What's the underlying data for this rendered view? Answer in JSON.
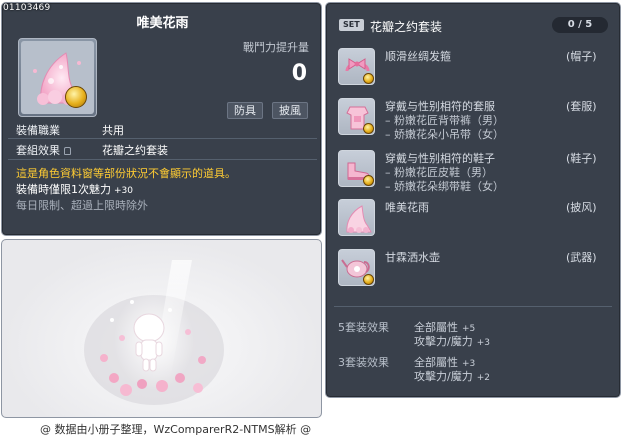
{
  "item": {
    "id": "01103469",
    "name": "唯美花雨",
    "power_label": "戰鬥力提升量",
    "power_value": "0",
    "tags": [
      "防具",
      "披風"
    ],
    "job_label": "裝備職業",
    "job_value": "共用",
    "set_label": "套組效果",
    "set_value": "花瓣之约套装",
    "warning": "這是角色資料窗等部份狀況不會顯示的道具。",
    "bonus_label": "裝備時僅限1次魅力",
    "bonus_value": "+30",
    "note": "每日限制、超過上限時除外"
  },
  "set": {
    "badge": "SET",
    "name": "花瓣之约套装",
    "count": "0 / 5",
    "pieces": [
      {
        "name": "顺滑丝绸发箍",
        "slot": "(帽子)",
        "subs": []
      },
      {
        "name": "穿戴与性别相符的套服",
        "slot": "(套服)",
        "subs": [
          "– 粉嫩花匠背带裤（男）",
          "– 娇嫩花朵小吊带（女）"
        ]
      },
      {
        "name": "穿戴与性别相符的鞋子",
        "slot": "(鞋子)",
        "subs": [
          "– 粉嫩花匠皮鞋（男）",
          "– 娇嫩花朵绑带鞋（女）"
        ]
      },
      {
        "name": "唯美花雨",
        "slot": "(披风)",
        "subs": []
      },
      {
        "name": "甘霖洒水壶",
        "slot": "(武器)",
        "subs": []
      }
    ],
    "effects": [
      {
        "level": "5套装效果",
        "stats": [
          {
            "name": "全部屬性",
            "value": "+5"
          },
          {
            "name": "攻擊力/魔力",
            "value": "+3"
          }
        ]
      },
      {
        "level": "3套装效果",
        "stats": [
          {
            "name": "全部屬性",
            "value": "+3"
          },
          {
            "name": "攻擊力/魔力",
            "value": "+2"
          }
        ]
      }
    ]
  },
  "footer": "@ 数据由小册子整理，WzComparerR2-NTMS解析 @",
  "colors": {
    "panel": "#39404b",
    "warning": "#ffcc33",
    "border": "#8e96a3"
  },
  "icons": [
    "petal-cape-icon",
    "coin-icon",
    "ribbon-headband-icon",
    "overall-icon",
    "shoes-icon",
    "watering-can-icon",
    "lock-icon"
  ]
}
